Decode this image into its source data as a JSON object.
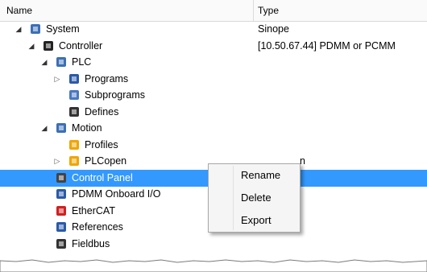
{
  "header": {
    "name_label": "Name",
    "type_label": "Type"
  },
  "tree": [
    {
      "label": "System",
      "type": "Sinope",
      "icon": "system-icon",
      "color": "#3c6fb5",
      "arrow": "open"
    },
    {
      "label": "Controller",
      "type": "[10.50.67.44] PDMM or PCMM",
      "icon": "controller-icon",
      "color": "#222222",
      "arrow": "open"
    },
    {
      "label": "PLC",
      "type": "",
      "icon": "plc-icon",
      "color": "#3c6fb5",
      "arrow": "open"
    },
    {
      "label": "Programs",
      "type": "",
      "icon": "programs-icon",
      "color": "#2a5aa8",
      "arrow": "closed"
    },
    {
      "label": "Subprograms",
      "type": "",
      "icon": "subprograms-icon",
      "color": "#4a78c0",
      "arrow": "none"
    },
    {
      "label": "Defines",
      "type": "",
      "icon": "defines-icon",
      "color": "#333333",
      "arrow": "none"
    },
    {
      "label": "Motion",
      "type": "",
      "icon": "motion-icon",
      "color": "#3c6fb5",
      "arrow": "open"
    },
    {
      "label": "Profiles",
      "type": "",
      "icon": "profiles-icon",
      "color": "#f0a500",
      "arrow": "none"
    },
    {
      "label": "PLCopen",
      "type": "n",
      "icon": "plcopen-icon",
      "color": "#f0a500",
      "arrow": "closed"
    },
    {
      "label": "Control Panel",
      "type": "",
      "icon": "control-panel-icon",
      "color": "#444444",
      "arrow": "none",
      "selected": true
    },
    {
      "label": "PDMM Onboard I/O",
      "type": "",
      "icon": "onboard-io-icon",
      "color": "#2a5aa8",
      "arrow": "none"
    },
    {
      "label": "EtherCAT",
      "type": "",
      "icon": "ethercat-icon",
      "color": "#d02020",
      "arrow": "none"
    },
    {
      "label": "References",
      "type": "",
      "icon": "references-icon",
      "color": "#2a5aa8",
      "arrow": "none"
    },
    {
      "label": "Fieldbus",
      "type": "",
      "icon": "fieldbus-icon",
      "color": "#333333",
      "arrow": "none"
    }
  ],
  "context_menu": {
    "items": [
      "Rename",
      "Delete",
      "Export"
    ]
  }
}
